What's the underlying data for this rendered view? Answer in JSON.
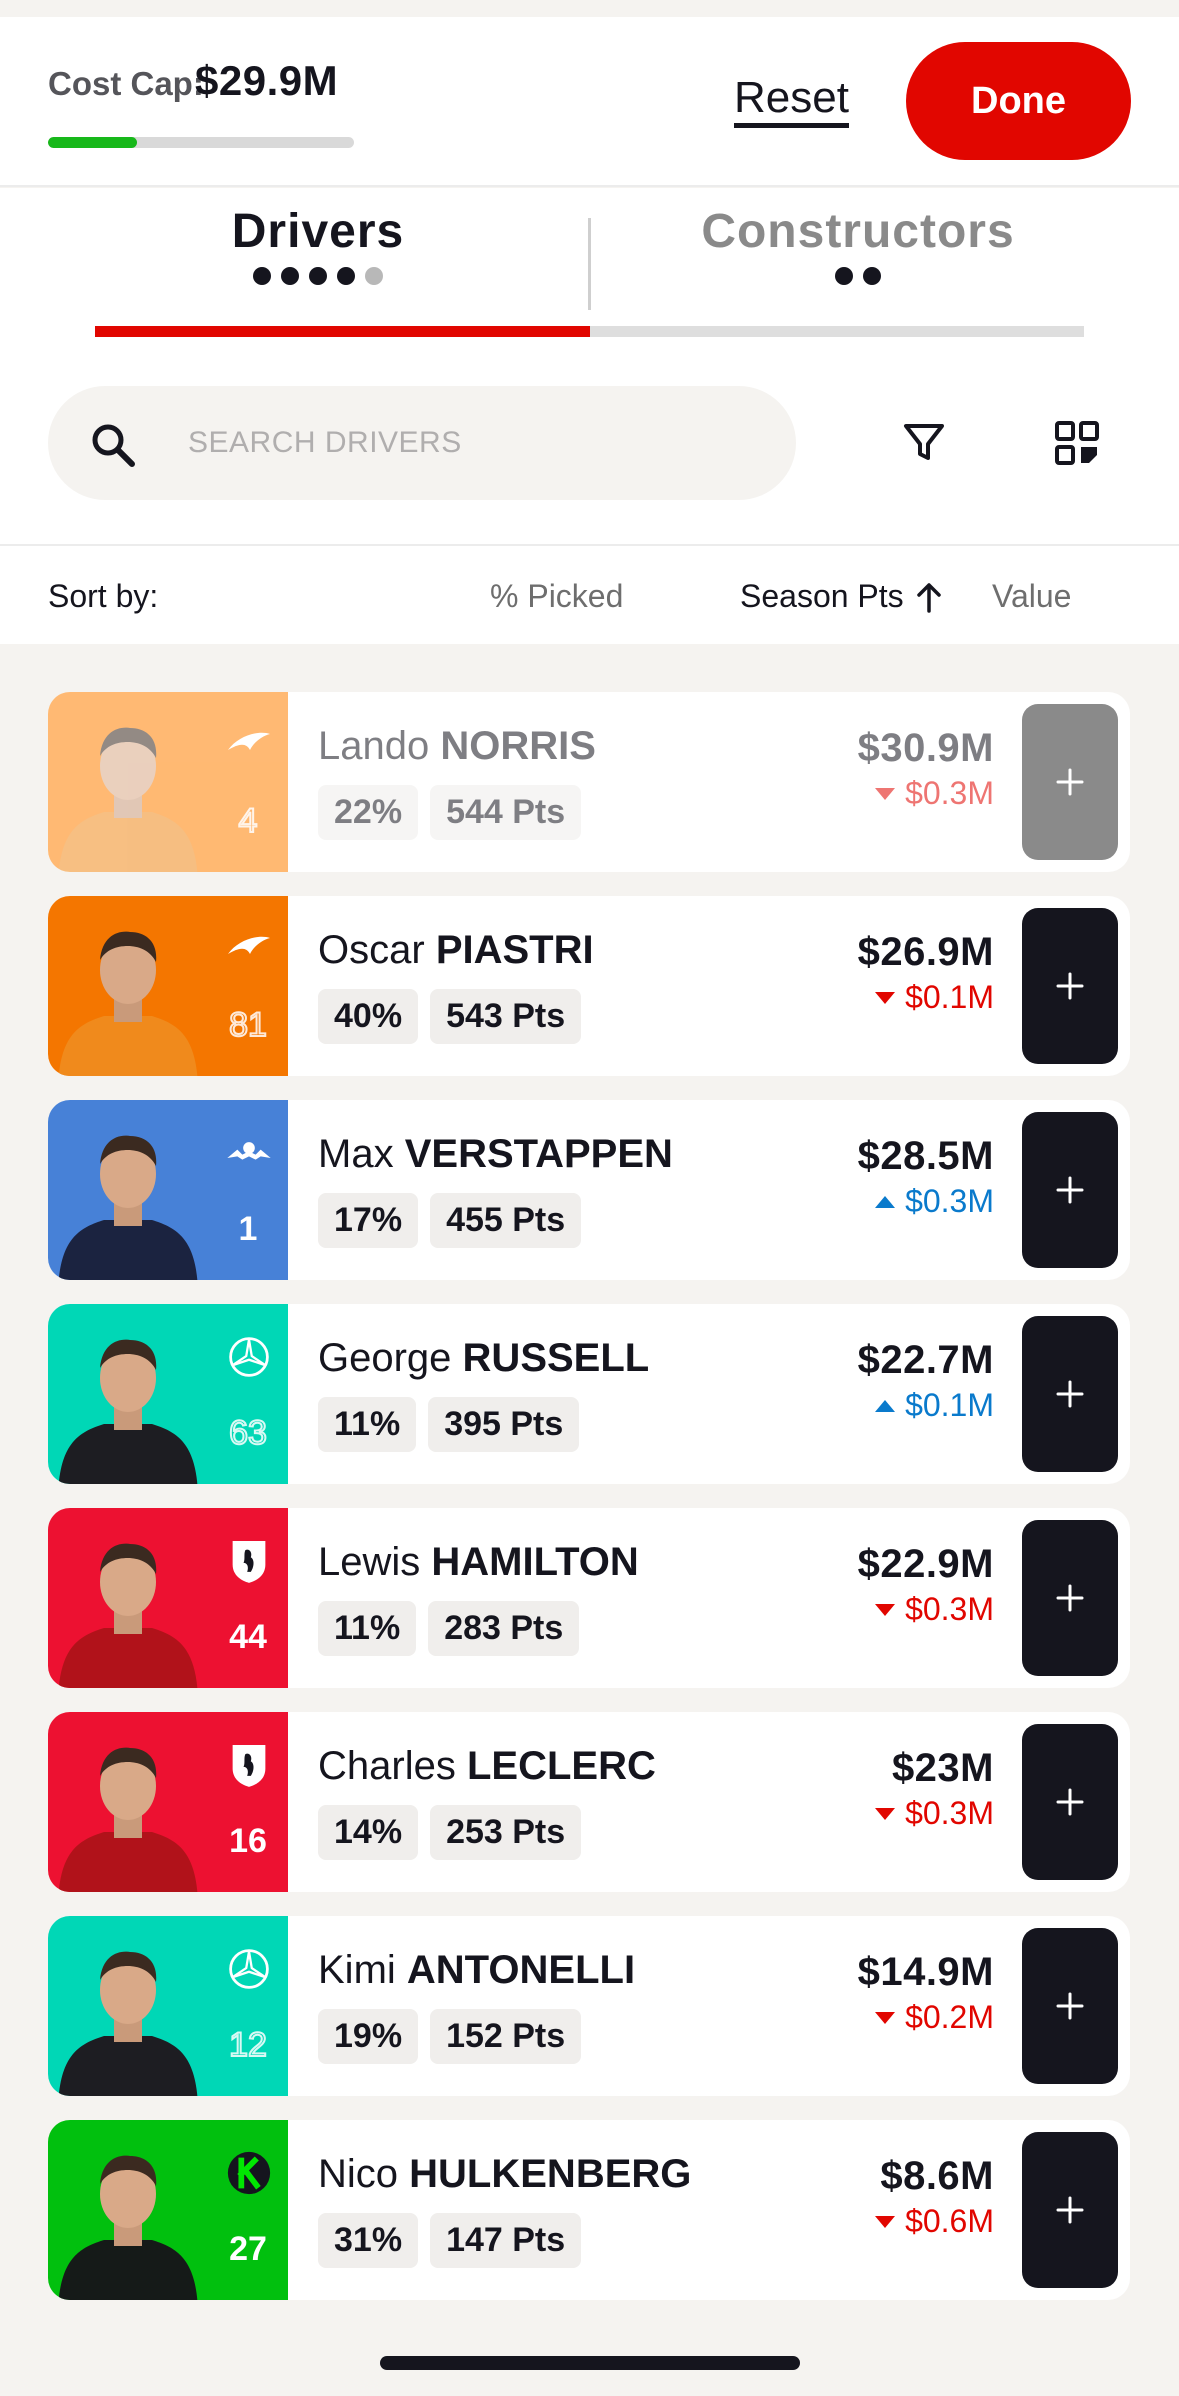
{
  "header": {
    "cost_cap_label": "Cost Cap:",
    "cost_cap_value": "$29.9M",
    "cost_cap_used_fraction": 0.29,
    "reset_label": "Reset",
    "done_label": "Done"
  },
  "tabs": [
    {
      "label": "Drivers",
      "filled": 4,
      "total": 5,
      "active": true
    },
    {
      "label": "Constructors",
      "filled": 2,
      "total": 2,
      "active": false
    }
  ],
  "search": {
    "placeholder": "SEARCH DRIVERS"
  },
  "sort": {
    "label": "Sort by:",
    "picked": "% Picked",
    "season": "Season Pts",
    "value": "Value"
  },
  "drivers": [
    {
      "first": "Lando",
      "last": "NORRIS",
      "picked": "22%",
      "points": "544 Pts",
      "price": "$30.9M",
      "change": "$0.3M",
      "direction": "down",
      "number": "4",
      "number_style": "outline",
      "team": "mclaren",
      "team_color": "#ff8000",
      "dimmed": true
    },
    {
      "first": "Oscar",
      "last": "PIASTRI",
      "picked": "40%",
      "points": "543 Pts",
      "price": "$26.9M",
      "change": "$0.1M",
      "direction": "down",
      "number": "81",
      "number_style": "outline",
      "team": "mclaren",
      "team_color": "#f47600",
      "dimmed": false
    },
    {
      "first": "Max",
      "last": "VERSTAPPEN",
      "picked": "17%",
      "points": "455 Pts",
      "price": "$28.5M",
      "change": "$0.3M",
      "direction": "up",
      "number": "1",
      "number_style": "solid",
      "team": "redbull",
      "team_color": "#4781d7",
      "dimmed": false
    },
    {
      "first": "George",
      "last": "RUSSELL",
      "picked": "11%",
      "points": "395 Pts",
      "price": "$22.7M",
      "change": "$0.1M",
      "direction": "up",
      "number": "63",
      "number_style": "outline",
      "team": "mercedes",
      "team_color": "#00d7b6",
      "dimmed": false
    },
    {
      "first": "Lewis",
      "last": "HAMILTON",
      "picked": "11%",
      "points": "283 Pts",
      "price": "$22.9M",
      "change": "$0.3M",
      "direction": "down",
      "number": "44",
      "number_style": "solid",
      "team": "ferrari",
      "team_color": "#ed1131",
      "dimmed": false
    },
    {
      "first": "Charles",
      "last": "LECLERC",
      "picked": "14%",
      "points": "253 Pts",
      "price": "$23M",
      "change": "$0.3M",
      "direction": "down",
      "number": "16",
      "number_style": "solid",
      "team": "ferrari",
      "team_color": "#ed1131",
      "dimmed": false
    },
    {
      "first": "Kimi",
      "last": "ANTONELLI",
      "picked": "19%",
      "points": "152 Pts",
      "price": "$14.9M",
      "change": "$0.2M",
      "direction": "down",
      "number": "12",
      "number_style": "outline",
      "team": "mercedes",
      "team_color": "#00d7b6",
      "dimmed": false
    },
    {
      "first": "Nico",
      "last": "HULKENBERG",
      "picked": "31%",
      "points": "147 Pts",
      "price": "$8.6M",
      "change": "$0.6M",
      "direction": "down",
      "number": "27",
      "number_style": "solid",
      "team": "sauber",
      "team_color": "#01c00e",
      "dimmed": false
    }
  ],
  "colors": {
    "accent": "#e10600",
    "cap_fill": "#17b81a",
    "price_down": "#e10600",
    "price_up": "#0a7acc",
    "add_button": "#15151e"
  },
  "icons": {
    "search": "search-icon",
    "filter": "filter-icon",
    "grid": "grid-view-icon",
    "add": "plus-icon",
    "sort": "arrow-up-icon"
  }
}
